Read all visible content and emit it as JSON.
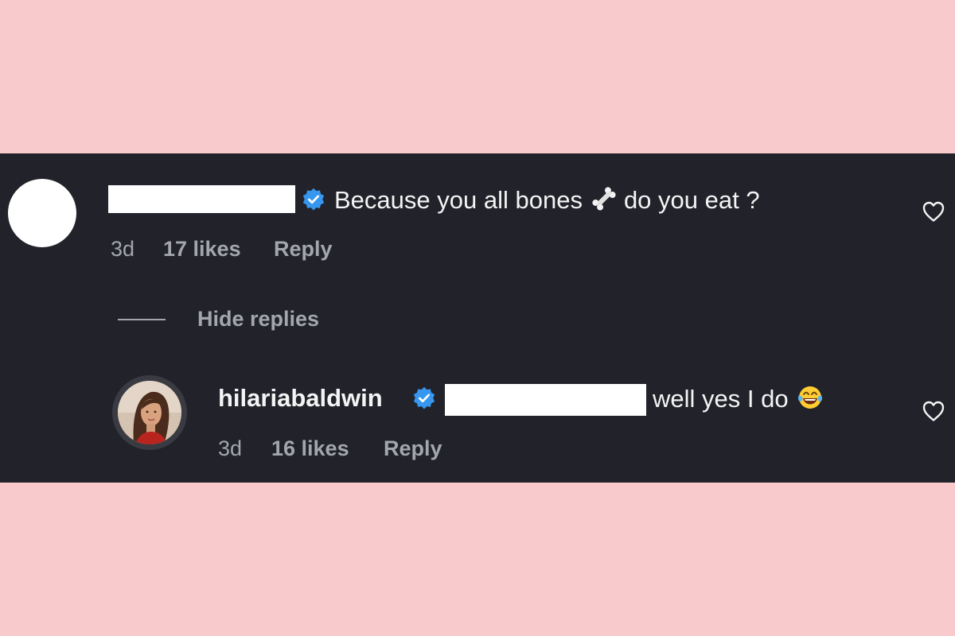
{
  "colors": {
    "page_background": "#f9cacc",
    "panel_background": "#22232a",
    "verified_badge": "#3797f0",
    "primary_text": "#f4f4f5",
    "secondary_text": "#a3a6ad"
  },
  "comment": {
    "verified": true,
    "text_before_emoji": "Because you all bones",
    "emoji": "bone-emoji",
    "text_after_emoji": "do you eat ?",
    "time": "3d",
    "likes": "17 likes",
    "reply_label": "Reply",
    "like_icon": "heart-outline-icon"
  },
  "replies_toggle": {
    "label": "Hide replies"
  },
  "reply": {
    "username": "hilariabaldwin",
    "verified": true,
    "text": "well yes I do",
    "emoji": "tears-of-joy-emoji",
    "time": "3d",
    "likes": "16 likes",
    "reply_label": "Reply",
    "like_icon": "heart-outline-icon"
  }
}
